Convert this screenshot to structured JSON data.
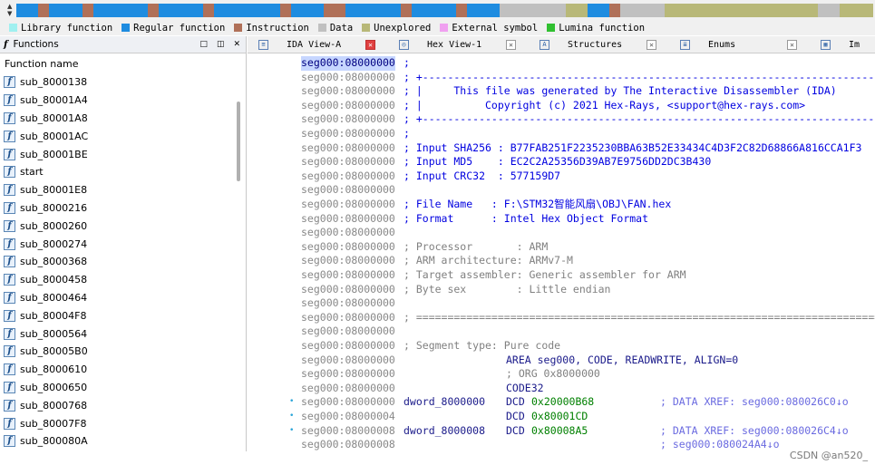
{
  "legend": [
    {
      "label": "Library function",
      "color": "#a0f0f0"
    },
    {
      "label": "Regular function",
      "color": "#1e8ce0"
    },
    {
      "label": "Instruction",
      "color": "#b07058"
    },
    {
      "label": "Data",
      "color": "#c0c0c0"
    },
    {
      "label": "Unexplored",
      "color": "#b8b878"
    },
    {
      "label": "External symbol",
      "color": "#f0a0f0"
    },
    {
      "label": "Lumina function",
      "color": "#30c030"
    }
  ],
  "functions_panel": {
    "title": "Functions",
    "column_header": "Function name",
    "items": [
      "sub_8000138",
      "sub_80001A4",
      "sub_80001A8",
      "sub_80001AC",
      "sub_80001BE",
      "start",
      "sub_80001E8",
      "sub_8000216",
      "sub_8000260",
      "sub_8000274",
      "sub_8000368",
      "sub_8000458",
      "sub_8000464",
      "sub_80004F8",
      "sub_8000564",
      "sub_80005B0",
      "sub_8000610",
      "sub_8000650",
      "sub_8000768",
      "sub_80007F8",
      "sub_800080A"
    ]
  },
  "tabs": [
    {
      "label": "IDA View-A",
      "icon": "ida-view-icon",
      "active": true
    },
    {
      "label": "Hex View-1",
      "icon": "hex-view-icon",
      "active": false
    },
    {
      "label": "Structures",
      "icon": "structures-icon",
      "active": false
    },
    {
      "label": "Enums",
      "icon": "enums-icon",
      "active": false
    },
    {
      "label": "Im",
      "icon": "imports-icon",
      "active": false
    }
  ],
  "disasm": [
    {
      "addr": "seg000:08000000",
      "comment": ";"
    },
    {
      "addr": "seg000:08000000",
      "comment": "; +-------------------------------------------------------------------------"
    },
    {
      "addr": "seg000:08000000",
      "comment": "; |     This file was generated by The Interactive Disassembler (IDA)"
    },
    {
      "addr": "seg000:08000000",
      "comment": "; |          Copyright (c) 2021 Hex-Rays, <support@hex-rays.com>"
    },
    {
      "addr": "seg000:08000000",
      "comment": "; +-------------------------------------------------------------------------"
    },
    {
      "addr": "seg000:08000000",
      "comment": ";"
    },
    {
      "addr": "seg000:08000000",
      "comment": "; Input SHA256 : B77FAB251F2235230BBA63B52E33434C4D3F2C82D68866A816CCA1F3"
    },
    {
      "addr": "seg000:08000000",
      "comment": "; Input MD5    : EC2C2A25356D39AB7E9756DD2DC3B430"
    },
    {
      "addr": "seg000:08000000",
      "comment": "; Input CRC32  : 577159D7"
    },
    {
      "addr": "seg000:08000000",
      "comment": ""
    },
    {
      "addr": "seg000:08000000",
      "comment": "; File Name   : F:\\STM32智能风扇\\OBJ\\FAN.hex"
    },
    {
      "addr": "seg000:08000000",
      "comment": "; Format      : Intel Hex Object Format"
    },
    {
      "addr": "seg000:08000000",
      "comment": ""
    },
    {
      "addr": "seg000:08000000",
      "comment": "; Processor       : ARM",
      "gray": true
    },
    {
      "addr": "seg000:08000000",
      "comment": "; ARM architecture: ARMv7-M",
      "gray": true
    },
    {
      "addr": "seg000:08000000",
      "comment": "; Target assembler: Generic assembler for ARM",
      "gray": true
    },
    {
      "addr": "seg000:08000000",
      "comment": "; Byte sex        : Little endian",
      "gray": true
    },
    {
      "addr": "seg000:08000000",
      "comment": ""
    },
    {
      "addr": "seg000:08000000",
      "comment": "; ===========================================================================",
      "gray": true
    },
    {
      "addr": "seg000:08000000",
      "comment": ""
    },
    {
      "addr": "seg000:08000000",
      "comment": "; Segment type: Pure code",
      "gray": true
    },
    {
      "addr": "seg000:08000000",
      "ins": "AREA seg000, CODE, READWRITE, ALIGN=0",
      "ins_offset": true
    },
    {
      "addr": "seg000:08000000",
      "comment": "; ORG 0x8000000",
      "gray": true,
      "indent": true
    },
    {
      "addr": "seg000:08000000",
      "ins": "CODE32",
      "ins_offset": true
    },
    {
      "addr": "seg000:08000000",
      "label": "dword_8000000",
      "ins": "DCD",
      "opn": "0x20000B68",
      "xref": "; DATA XREF: seg000:080026C0↓o",
      "bullet": true
    },
    {
      "addr": "seg000:08000004",
      "ins": "DCD",
      "opn": "0x80001CD",
      "bullet": true
    },
    {
      "addr": "seg000:08000008",
      "label": "dword_8000008",
      "ins": "DCD",
      "opn": "0x80008A5",
      "xref": "; DATA XREF: seg000:080026C4↓o",
      "bullet": true
    },
    {
      "addr": "seg000:08000008",
      "xref": "; seg000:080024A4↓o"
    }
  ],
  "watermark": "CSDN @an520_"
}
